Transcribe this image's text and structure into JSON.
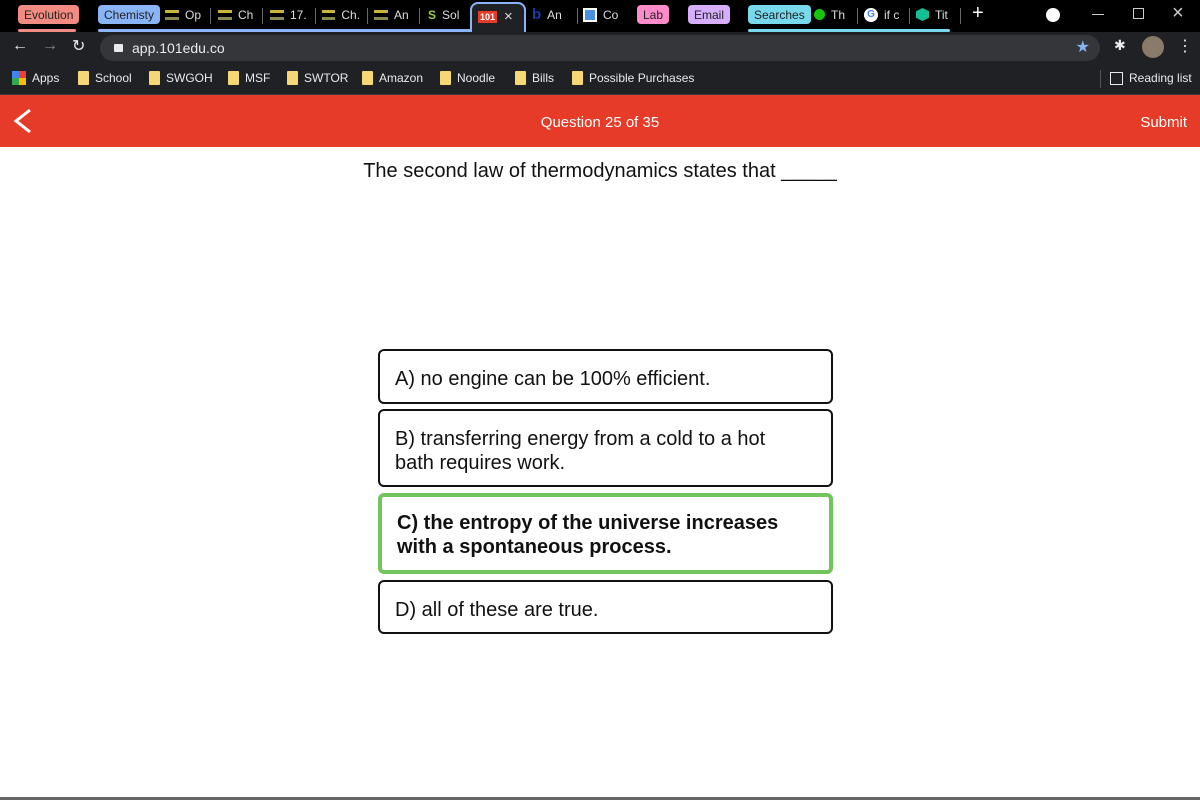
{
  "browser": {
    "tab_groups": [
      {
        "label": "Evolution",
        "color": "#f28b82"
      },
      {
        "label": "Chemisty",
        "color": "#8ab4f8"
      },
      {
        "label": "Lab",
        "color": "#ff8bcb"
      },
      {
        "label": "Email",
        "color": "#d7aefb"
      },
      {
        "label": "Searches",
        "color": "#78d9ec"
      }
    ],
    "tabs": [
      "Op",
      "Ch",
      "17.",
      "Ch.",
      "An",
      "Sol",
      "An",
      "Co",
      "Th",
      "if c",
      "Tit"
    ],
    "active_tab_icon": "101",
    "url": "app.101edu.co",
    "bookmarks": [
      "Apps",
      "School",
      "SWGOH",
      "MSF",
      "SWTOR",
      "Amazon",
      "Noodle",
      "Bills",
      "Possible Purchases"
    ],
    "reading_list": "Reading list"
  },
  "header": {
    "question_counter": "Question 25 of 35",
    "submit_label": "Submit",
    "accent": "#e63b28"
  },
  "question": {
    "text": "The second law of thermodynamics states that _____"
  },
  "options": [
    {
      "text": "A) no engine can be 100% efficient.",
      "selected": false
    },
    {
      "text": "B) transferring energy from a cold to a hot bath requires work.",
      "selected": false
    },
    {
      "text": "C) the entropy of the universe increases with a spontaneous process.",
      "selected": true
    },
    {
      "text": "D) all of these are true.",
      "selected": false
    }
  ],
  "selected_color": "#72c55c"
}
